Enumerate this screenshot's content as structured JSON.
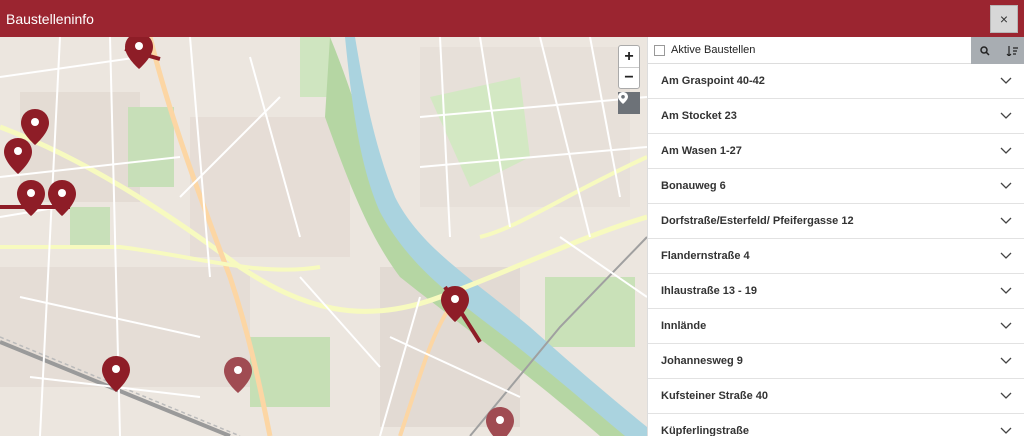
{
  "window": {
    "title": "Baustelleninfo",
    "close_label": "×"
  },
  "map": {
    "zoom_in": "+",
    "zoom_out": "−",
    "colors": {
      "marker": "#8e1d27",
      "river": "#aad3df",
      "forest": "#add19e",
      "road_major": "#f7fabf",
      "road_minor": "#ffffff"
    }
  },
  "panel": {
    "filter_label": "Aktive Baustellen",
    "items": [
      {
        "label": "Am Graspoint 40-42"
      },
      {
        "label": "Am Stocket 23"
      },
      {
        "label": "Am Wasen 1-27"
      },
      {
        "label": "Bonauweg 6"
      },
      {
        "label": "Dorfstraße/Esterfeld/ Pfeifergasse 12"
      },
      {
        "label": "Flandernstraße 4"
      },
      {
        "label": "Ihlaustraße 13 - 19"
      },
      {
        "label": "Innlände"
      },
      {
        "label": "Johannesweg 9"
      },
      {
        "label": "Kufsteiner Straße 40"
      },
      {
        "label": "Küpferlingstraße"
      }
    ]
  },
  "accent": "#9b2530"
}
